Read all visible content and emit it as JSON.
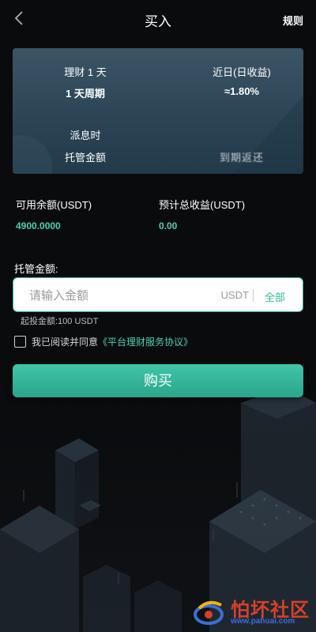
{
  "header": {
    "title": "买入",
    "rules_label": "规则"
  },
  "product_card": {
    "product_name": "理财 1 天",
    "recent_yield_label": "近日(日收益)",
    "period": "1 天周期",
    "daily_rate": "≈1.80%",
    "payout_label": "派息时",
    "payout_value": "",
    "custody_label": "托管金额",
    "custody_value": "到期返还"
  },
  "stats": {
    "available_label": "可用余额(USDT)",
    "available_value": "4900.0000",
    "expected_label": "预计总收益(USDT)",
    "expected_value": "0.00"
  },
  "amount": {
    "label": "托管金额:",
    "placeholder": "请输入金额",
    "value": "",
    "unit": "USDT",
    "all_label": "全部",
    "min_text": "起投金额:100 USDT"
  },
  "agreement": {
    "prefix": "我已阅读并同意",
    "link": "《平台理财服务协议》",
    "checked": false
  },
  "buy_button": {
    "label": "购买"
  },
  "watermark": {
    "text": "怕坏社区",
    "url": "www.pahuai.com"
  },
  "colors": {
    "accent": "#2fb998",
    "accent_text": "#4fd1b2",
    "background": "#0a0b0d",
    "card": "#2c4556"
  }
}
